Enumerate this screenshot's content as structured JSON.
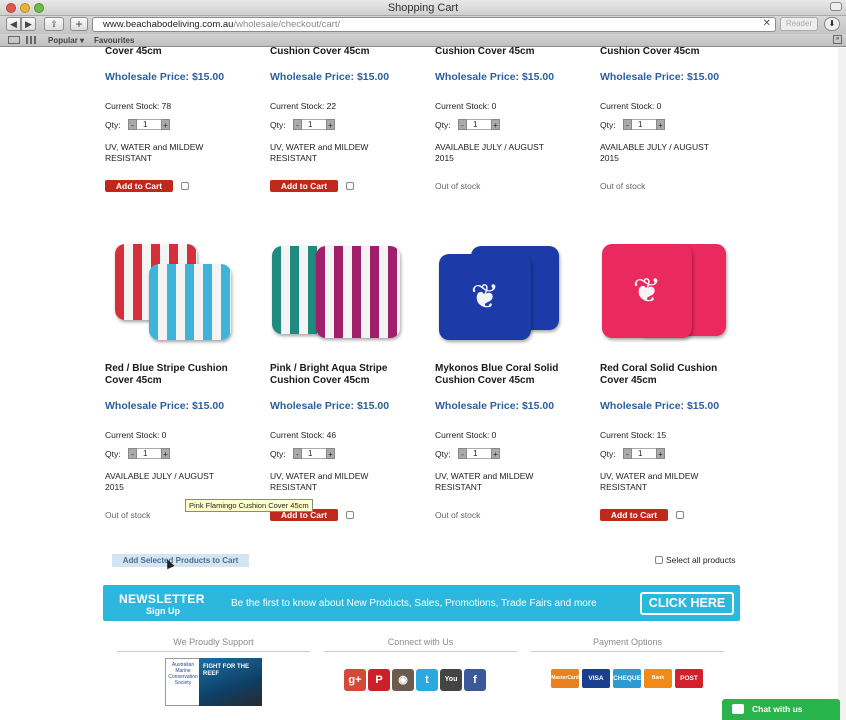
{
  "window": {
    "title": "Shopping Cart"
  },
  "toolbar": {
    "back": "◀",
    "forward": "▶",
    "share": "⇪",
    "new_tab": "+",
    "url_domain": "www.beachabodeliving.com.au",
    "url_path": "/wholesale/checkout/cart/",
    "clear": "✕",
    "reader": "Reader",
    "download": "⬇"
  },
  "bookmarks": {
    "popular": "Popular ▾",
    "favourites": "Favourites"
  },
  "row1": [
    {
      "name_tail": "Cover 45cm",
      "price": "Wholesale Price: $15.00",
      "stock": "Current Stock: 78",
      "qty_label": "Qty:",
      "minus": "-",
      "qty": "1",
      "plus": "+",
      "note": "UV, WATER and MILDEW RESISTANT",
      "button": "Add to Cart"
    },
    {
      "name_tail": "Cushion Cover 45cm",
      "price": "Wholesale Price: $15.00",
      "stock": "Current Stock: 22",
      "qty_label": "Qty:",
      "minus": "-",
      "qty": "1",
      "plus": "+",
      "note": "UV, WATER and MILDEW RESISTANT",
      "button": "Add to Cart"
    },
    {
      "name_tail": "Cushion Cover 45cm",
      "price": "Wholesale Price: $15.00",
      "stock": "Current Stock: 0",
      "qty_label": "Qty:",
      "minus": "-",
      "qty": "1",
      "plus": "+",
      "note": "AVAILABLE JULY / AUGUST 2015",
      "status": "Out of stock"
    },
    {
      "name_tail": "Cushion Cover 45cm",
      "price": "Wholesale Price: $15.00",
      "stock": "Current Stock: 0",
      "qty_label": "Qty:",
      "minus": "-",
      "qty": "1",
      "plus": "+",
      "note": "AVAILABLE JULY / AUGUST 2015",
      "status": "Out of stock"
    }
  ],
  "row2": [
    {
      "name": "Red / Blue Stripe Cushion Cover 45cm",
      "price": "Wholesale Price: $15.00",
      "stock": "Current Stock: 0",
      "qty_label": "Qty:",
      "minus": "-",
      "qty": "1",
      "plus": "+",
      "note": "AVAILABLE JULY / AUGUST 2015",
      "status": "Out of stock"
    },
    {
      "name": "Pink / Bright Aqua Stripe Cushion Cover 45cm",
      "price": "Wholesale Price: $15.00",
      "stock": "Current Stock: 46",
      "qty_label": "Qty:",
      "minus": "-",
      "qty": "1",
      "plus": "+",
      "note": "UV, WATER and MILDEW RESISTANT",
      "button": "Add to Cart"
    },
    {
      "name": "Mykonos Blue Coral Solid Cushion Cover 45cm",
      "price": "Wholesale Price: $15.00",
      "stock": "Current Stock: 0",
      "qty_label": "Qty:",
      "minus": "-",
      "qty": "1",
      "plus": "+",
      "note": "UV, WATER and MILDEW RESISTANT",
      "status": "Out of stock"
    },
    {
      "name": "Red Coral Solid Cushion Cover 45cm",
      "price": "Wholesale Price: $15.00",
      "stock": "Current Stock: 15",
      "qty_label": "Qty:",
      "minus": "-",
      "qty": "1",
      "plus": "+",
      "note": "UV, WATER and MILDEW RESISTANT",
      "button": "Add to Cart"
    }
  ],
  "tooltip": "Pink Flamingo Cushion Cover 45cm",
  "actions": {
    "add_selected": "Add Selected Products to Cart",
    "select_all": "Select all products"
  },
  "newsletter": {
    "title": "NEWSLETTER",
    "subtitle": "Sign Up",
    "text": "Be the first to know about New Products, Sales, Promotions, Trade Fairs and more",
    "button": "CLICK HERE"
  },
  "footer": {
    "support_title": "We Proudly Support",
    "connect_title": "Connect with Us",
    "payment_title": "Payment Options",
    "support_logo1": "Australian Marine Conservation Society",
    "support_logo2": "FIGHT FOR THE REEF",
    "social": [
      {
        "name": "google-plus",
        "glyph": "g+",
        "color": "#d34836"
      },
      {
        "name": "pinterest",
        "glyph": "P",
        "color": "#cb2027"
      },
      {
        "name": "instagram",
        "glyph": "◉",
        "color": "#6b5a4e"
      },
      {
        "name": "twitter",
        "glyph": "t",
        "color": "#2aa9e0"
      },
      {
        "name": "youtube",
        "glyph": "You",
        "color": "#444444"
      },
      {
        "name": "facebook",
        "glyph": "f",
        "color": "#3b5998"
      }
    ],
    "payments": [
      {
        "name": "mastercard",
        "label": "MasterCard",
        "color": "#e7821f"
      },
      {
        "name": "visa",
        "label": "VISA",
        "color": "#1a3f8f"
      },
      {
        "name": "cheque",
        "label": "CHEQUE",
        "color": "#2d9bd2"
      },
      {
        "name": "bank-deposit",
        "label": "Bank Deposit",
        "color": "#f08a18"
      },
      {
        "name": "auspost",
        "label": "POST",
        "color": "#d3202f"
      }
    ]
  },
  "chat": {
    "label": "Chat with us"
  }
}
